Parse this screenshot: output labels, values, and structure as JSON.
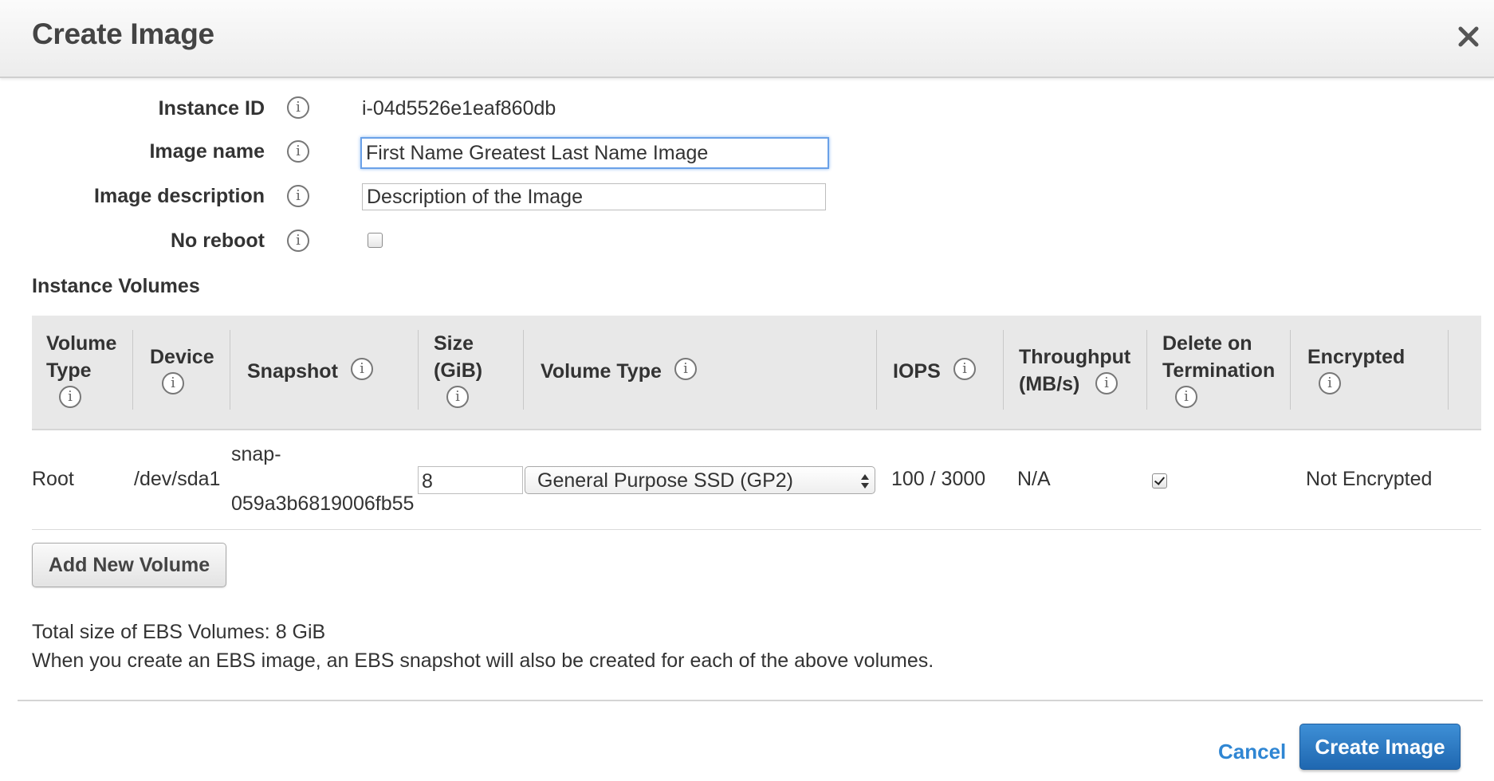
{
  "dialog": {
    "title": "Create Image",
    "close_icon": "close-icon"
  },
  "form": {
    "instance_id": {
      "label": "Instance ID",
      "value": "i-04d5526e1eaf860db"
    },
    "image_name": {
      "label": "Image name",
      "value": "First Name Greatest Last Name Image"
    },
    "image_description": {
      "label": "Image description",
      "value": "Description of the Image"
    },
    "no_reboot": {
      "label": "No reboot",
      "checked": false
    },
    "info_icon": "info-icon"
  },
  "volumes": {
    "title": "Instance Volumes",
    "headers": {
      "volume_type_l1": "Volume",
      "volume_type_l2": "Type",
      "device": "Device",
      "snapshot": "Snapshot",
      "size_l1": "Size",
      "size_l2": "(GiB)",
      "vol_type": "Volume Type",
      "iops": "IOPS",
      "throughput_l1": "Throughput",
      "throughput_l2": "(MB/s)",
      "delete_l1": "Delete on",
      "delete_l2": "Termination",
      "encrypted": "Encrypted"
    },
    "rows": [
      {
        "volume_type": "Root",
        "device": "/dev/sda1",
        "snapshot_l1": "snap-",
        "snapshot_l2": "059a3b6819006fb55",
        "size": "8",
        "type_selected": "General Purpose SSD (GP2)",
        "iops": "100 / 3000",
        "throughput": "N/A",
        "delete_on_termination": true,
        "encrypted": "Not Encrypted"
      }
    ],
    "add_button": "Add New Volume"
  },
  "notes": {
    "total": "Total size of EBS Volumes: 8 GiB",
    "info": "When you create an EBS image, an EBS snapshot will also be created for each of the above volumes."
  },
  "footer": {
    "cancel": "Cancel",
    "create": "Create Image"
  },
  "colors": {
    "primary": "#2f86d3",
    "header_bg": "#e8e8e8"
  }
}
